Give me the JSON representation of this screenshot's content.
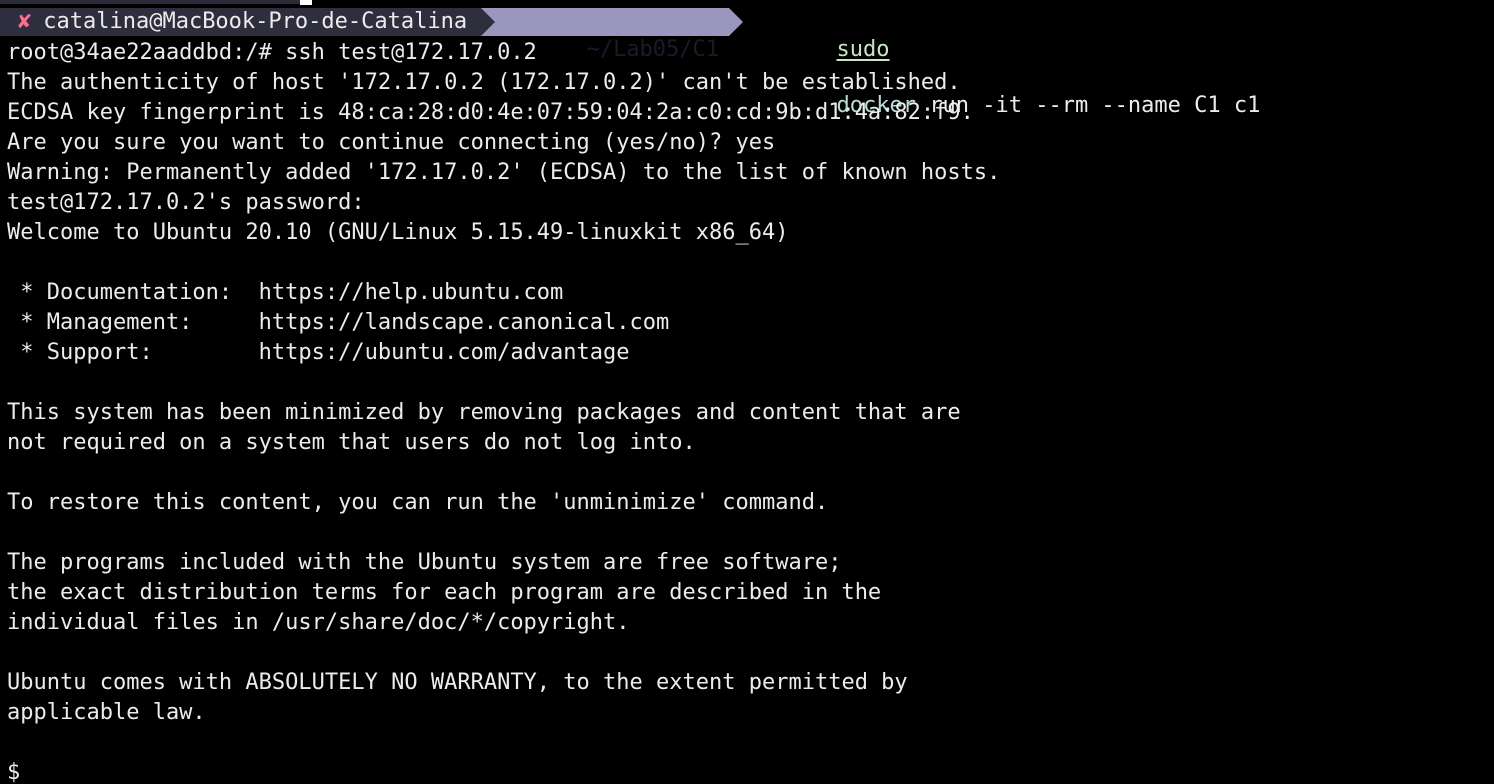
{
  "prompt": {
    "status_icon": "cross-icon",
    "status_glyph": "✘",
    "user_host": "catalina@MacBook-Pro-de-Catalina",
    "directory": "~/Lab05/C1",
    "command": {
      "sudo": "sudo",
      "docker": "docker",
      "args": " run -it --rm --name C1 c1"
    }
  },
  "colors": {
    "background": "#000000",
    "text": "#ececec",
    "segment_user_bg": "#2e2e3e",
    "segment_dir_bg": "#9a96bd",
    "error_icon": "#ff6f8d",
    "cmd_sudo": "#c8e6c4",
    "cmd_docker": "#b8dcd6"
  },
  "output_lines": [
    "root@34ae22aaddbd:/# ssh test@172.17.0.2",
    "The authenticity of host '172.17.0.2 (172.17.0.2)' can't be established.",
    "ECDSA key fingerprint is 48:ca:28:d0:4e:07:59:04:2a:c0:cd:9b:d1:4a:82:f9.",
    "Are you sure you want to continue connecting (yes/no)? yes",
    "Warning: Permanently added '172.17.0.2' (ECDSA) to the list of known hosts.",
    "test@172.17.0.2's password:",
    "Welcome to Ubuntu 20.10 (GNU/Linux 5.15.49-linuxkit x86_64)",
    "",
    " * Documentation:  https://help.ubuntu.com",
    " * Management:     https://landscape.canonical.com",
    " * Support:        https://ubuntu.com/advantage",
    "",
    "This system has been minimized by removing packages and content that are",
    "not required on a system that users do not log into.",
    "",
    "To restore this content, you can run the 'unminimize' command.",
    "",
    "The programs included with the Ubuntu system are free software;",
    "the exact distribution terms for each program are described in the",
    "individual files in /usr/share/doc/*/copyright.",
    "",
    "Ubuntu comes with ABSOLUTELY NO WARRANTY, to the extent permitted by",
    "applicable law.",
    "",
    "$"
  ]
}
